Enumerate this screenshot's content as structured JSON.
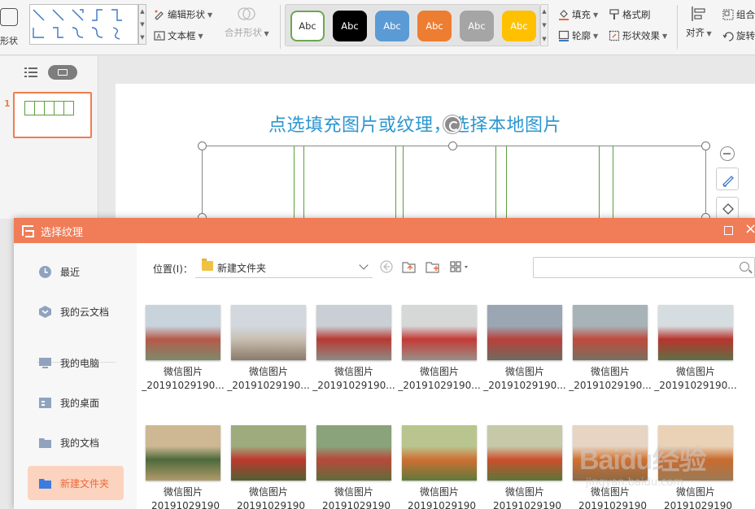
{
  "ribbon": {
    "shape_label": "形状",
    "edit_shape_label": "编辑形状",
    "text_box_label": "文本框",
    "merge_shape_label": "合并形状",
    "style_swatches": [
      {
        "label": "Abc",
        "bg": "#ffffff",
        "fg": "#333333",
        "border": "#6aa84f"
      },
      {
        "label": "Abc",
        "bg": "#000000",
        "fg": "#ffffff",
        "border": "#000000"
      },
      {
        "label": "Abc",
        "bg": "#5b9bd5",
        "fg": "#ffffff",
        "border": "#5b9bd5"
      },
      {
        "label": "Abc",
        "bg": "#ed7d31",
        "fg": "#ffffff",
        "border": "#ed7d31"
      },
      {
        "label": "Abc",
        "bg": "#a5a5a5",
        "fg": "#ffffff",
        "border": "#a5a5a5"
      },
      {
        "label": "Abc",
        "bg": "#ffc000",
        "fg": "#ffffff",
        "border": "#ffc000"
      }
    ],
    "fill_label": "填充",
    "outline_label": "轮廓",
    "format_painter_label": "格式刷",
    "shape_effect_label": "形状效果",
    "align_label": "对齐",
    "group_label": "组合",
    "rotate_label": "旋转"
  },
  "slides": [
    {
      "number": "1"
    }
  ],
  "slide": {
    "title": "点选填充图片或纹理，选择本地图片"
  },
  "dialog": {
    "title": "选择纹理",
    "accent": "#f07d57",
    "nav": [
      {
        "label": "最近",
        "icon": "clock-icon"
      },
      {
        "label": "我的云文档",
        "icon": "cloud-docs-icon"
      },
      {
        "label": "我的电脑",
        "icon": "computer-icon"
      },
      {
        "label": "我的桌面",
        "icon": "desktop-icon"
      },
      {
        "label": "我的文档",
        "icon": "folder-icon"
      },
      {
        "label": "新建文件夹",
        "icon": "folder-icon"
      }
    ],
    "location_label": "位置(I)：",
    "location_value": "新建文件夹",
    "search_placeholder": "",
    "files": [
      {
        "name": "微信图片",
        "sub": "_20191029190..."
      },
      {
        "name": "微信图片",
        "sub": "_20191029190..."
      },
      {
        "name": "微信图片",
        "sub": "_20191029190..."
      },
      {
        "name": "微信图片",
        "sub": "_20191029190..."
      },
      {
        "name": "微信图片",
        "sub": "_20191029190..."
      },
      {
        "name": "微信图片",
        "sub": "_20191029190..."
      },
      {
        "name": "微信图片",
        "sub": "_20191029190..."
      },
      {
        "name": "微信图片",
        "sub": "_20191029190"
      },
      {
        "name": "微信图片",
        "sub": "_20191029190"
      },
      {
        "name": "微信图片",
        "sub": "_20191029190"
      },
      {
        "name": "微信图片",
        "sub": "_20191029190"
      },
      {
        "name": "微信图片",
        "sub": "_20191029190"
      },
      {
        "name": "微信图片",
        "sub": "_20191029190"
      },
      {
        "name": "微信图片",
        "sub": "_20191029190"
      }
    ]
  },
  "watermark": {
    "text": "Baidu经验",
    "sub": "jingyan.baidu.com"
  }
}
